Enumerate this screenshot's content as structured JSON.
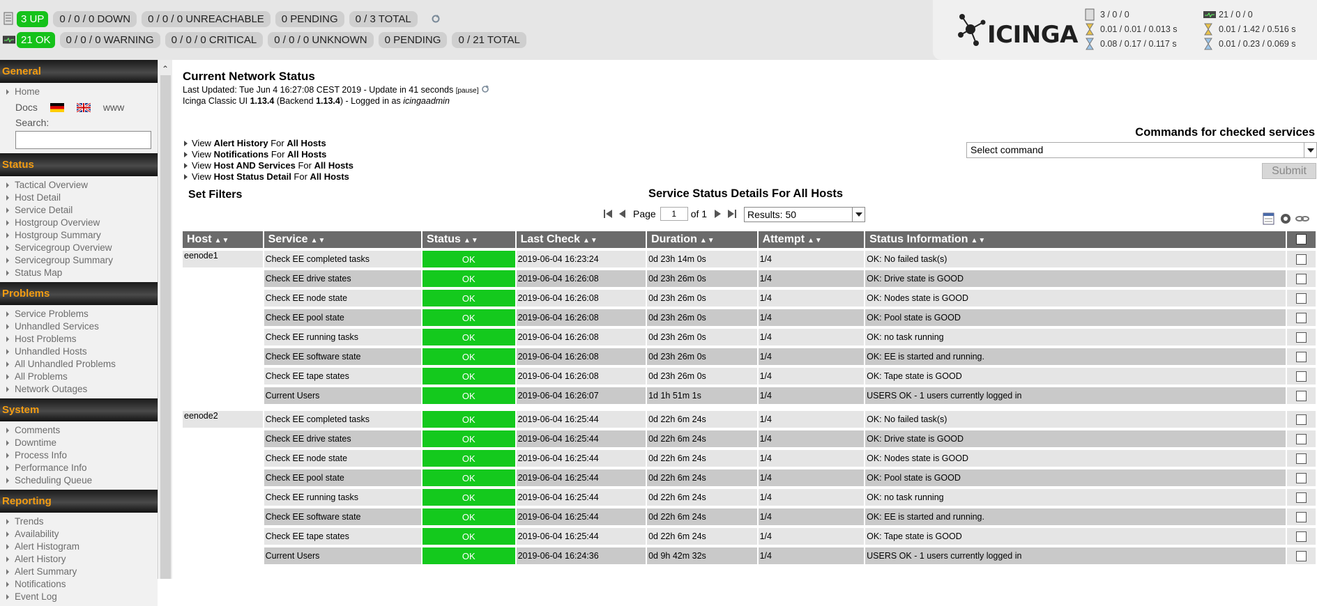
{
  "topbar": {
    "hosts": {
      "up": "3 UP",
      "down": "0 / 0 / 0 DOWN",
      "unreachable": "0 / 0 / 0 UNREACHABLE",
      "pending": "0 PENDING",
      "total": "0 / 3 TOTAL"
    },
    "services": {
      "ok": "21 OK",
      "warning": "0 / 0 / 0 WARNING",
      "critical": "0 / 0 / 0 CRITICAL",
      "unknown": "0 / 0 / 0 UNKNOWN",
      "pending": "0 PENDING",
      "total": "0 / 21 TOTAL"
    },
    "logo_text": "ICINGA",
    "host_stats": [
      "3 / 0 / 0",
      "0.01 / 0.01 / 0.013 s",
      "0.08 / 0.17 / 0.117 s"
    ],
    "service_stats": [
      "21 / 0 / 0",
      "0.01 / 1.42 / 0.516 s",
      "0.01 / 0.23 / 0.069 s"
    ],
    "icons": [
      "server-icon",
      "monitor-icon",
      "refresh-icon",
      "hourglass-icon"
    ],
    "colors": {
      "up": "#15c21a",
      "ok": "#14c91d",
      "section_title": "#f39c12"
    }
  },
  "sidebar": {
    "sections": [
      {
        "title": "General",
        "items": [
          "Home"
        ]
      },
      {
        "title": "Status",
        "items": [
          "Tactical Overview",
          "Host Detail",
          "Service Detail",
          "Hostgroup Overview",
          "Hostgroup Summary",
          "Servicegroup Overview",
          "Servicegroup Summary",
          "Status Map"
        ]
      },
      {
        "title": "Problems",
        "items": [
          "Service Problems",
          "Unhandled Services",
          "Host Problems",
          "Unhandled Hosts",
          "All Unhandled Problems",
          "All Problems",
          "Network Outages"
        ]
      },
      {
        "title": "System",
        "items": [
          "Comments",
          "Downtime",
          "Process Info",
          "Performance Info",
          "Scheduling Queue"
        ]
      },
      {
        "title": "Reporting",
        "items": [
          "Trends",
          "Availability",
          "Alert Histogram",
          "Alert History",
          "Alert Summary",
          "Notifications",
          "Event Log"
        ]
      }
    ],
    "docs": {
      "docs_label": "Docs",
      "www_label": "www"
    },
    "search_label": "Search:"
  },
  "main": {
    "title": "Current Network Status",
    "last_updated": {
      "prefix": "Last Updated: Tue Jun 4 16:27:08 CEST 2019 - Update in 41 seconds ",
      "pause": "[pause]"
    },
    "ui_line": {
      "prefix": "Icinga Classic UI ",
      "ui_version": "1.13.4",
      "middle": " (Backend ",
      "backend_version": "1.13.4",
      "after": ") - Logged in as ",
      "user": "icingaadmin"
    },
    "links": [
      {
        "pre": "View ",
        "bold": "Alert History",
        "mid": " For ",
        "bold2": "All Hosts"
      },
      {
        "pre": "View ",
        "bold": "Notifications",
        "mid": " For ",
        "bold2": "All Hosts"
      },
      {
        "pre": "View ",
        "bold": "Host AND Services",
        "mid": " For ",
        "bold2": "All Hosts"
      },
      {
        "pre": "View ",
        "bold": "Host Status Detail",
        "mid": " For ",
        "bold2": "All Hosts"
      }
    ],
    "commands_title": "Commands for checked services",
    "select_command": "Select command",
    "submit_label": "Submit",
    "set_filters": "Set Filters",
    "table_title": "Service Status Details For All Hosts",
    "pager": {
      "page_label": "Page",
      "page_value": "1",
      "of_label": "of 1",
      "results": "Results: 50"
    },
    "table": {
      "headers": [
        "Host",
        "Service",
        "Status",
        "Last Check",
        "Duration",
        "Attempt",
        "Status Information"
      ],
      "sort_glyph": "▲▼",
      "rows": [
        {
          "host": "eenode1",
          "service": "Check EE completed tasks",
          "status": "OK",
          "last_check": "2019-06-04 16:23:24",
          "duration": "0d 23h 14m 0s",
          "attempt": "1/4",
          "info": "OK: No failed task(s)"
        },
        {
          "host": "",
          "service": "Check EE drive states",
          "status": "OK",
          "last_check": "2019-06-04 16:26:08",
          "duration": "0d 23h 26m 0s",
          "attempt": "1/4",
          "info": "OK: Drive state is GOOD"
        },
        {
          "host": "",
          "service": "Check EE node state",
          "status": "OK",
          "last_check": "2019-06-04 16:26:08",
          "duration": "0d 23h 26m 0s",
          "attempt": "1/4",
          "info": "OK: Nodes state is GOOD"
        },
        {
          "host": "",
          "service": "Check EE pool state",
          "status": "OK",
          "last_check": "2019-06-04 16:26:08",
          "duration": "0d 23h 26m 0s",
          "attempt": "1/4",
          "info": "OK: Pool state is GOOD"
        },
        {
          "host": "",
          "service": "Check EE running tasks",
          "status": "OK",
          "last_check": "2019-06-04 16:26:08",
          "duration": "0d 23h 26m 0s",
          "attempt": "1/4",
          "info": "OK: no task running"
        },
        {
          "host": "",
          "service": "Check EE software state",
          "status": "OK",
          "last_check": "2019-06-04 16:26:08",
          "duration": "0d 23h 26m 0s",
          "attempt": "1/4",
          "info": "OK: EE is started and running."
        },
        {
          "host": "",
          "service": "Check EE tape states",
          "status": "OK",
          "last_check": "2019-06-04 16:26:08",
          "duration": "0d 23h 26m 0s",
          "attempt": "1/4",
          "info": "OK: Tape state is GOOD"
        },
        {
          "host": "",
          "service": "Current Users",
          "status": "OK",
          "last_check": "2019-06-04 16:26:07",
          "duration": "1d 1h 51m 1s",
          "attempt": "1/4",
          "info": "USERS OK - 1 users currently logged in"
        },
        {
          "host": "eenode2",
          "service": "Check EE completed tasks",
          "status": "OK",
          "last_check": "2019-06-04 16:25:44",
          "duration": "0d 22h 6m 24s",
          "attempt": "1/4",
          "info": "OK: No failed task(s)"
        },
        {
          "host": "",
          "service": "Check EE drive states",
          "status": "OK",
          "last_check": "2019-06-04 16:25:44",
          "duration": "0d 22h 6m 24s",
          "attempt": "1/4",
          "info": "OK: Drive state is GOOD"
        },
        {
          "host": "",
          "service": "Check EE node state",
          "status": "OK",
          "last_check": "2019-06-04 16:25:44",
          "duration": "0d 22h 6m 24s",
          "attempt": "1/4",
          "info": "OK: Nodes state is GOOD"
        },
        {
          "host": "",
          "service": "Check EE pool state",
          "status": "OK",
          "last_check": "2019-06-04 16:25:44",
          "duration": "0d 22h 6m 24s",
          "attempt": "1/4",
          "info": "OK: Pool state is GOOD"
        },
        {
          "host": "",
          "service": "Check EE running tasks",
          "status": "OK",
          "last_check": "2019-06-04 16:25:44",
          "duration": "0d 22h 6m 24s",
          "attempt": "1/4",
          "info": "OK: no task running"
        },
        {
          "host": "",
          "service": "Check EE software state",
          "status": "OK",
          "last_check": "2019-06-04 16:25:44",
          "duration": "0d 22h 6m 24s",
          "attempt": "1/4",
          "info": "OK: EE is started and running."
        },
        {
          "host": "",
          "service": "Check EE tape states",
          "status": "OK",
          "last_check": "2019-06-04 16:25:44",
          "duration": "0d 22h 6m 24s",
          "attempt": "1/4",
          "info": "OK: Tape state is GOOD"
        },
        {
          "host": "",
          "service": "Current Users",
          "status": "OK",
          "last_check": "2019-06-04 16:24:36",
          "duration": "0d 9h 42m 32s",
          "attempt": "1/4",
          "info": "USERS OK - 1 users currently logged in"
        }
      ]
    }
  }
}
